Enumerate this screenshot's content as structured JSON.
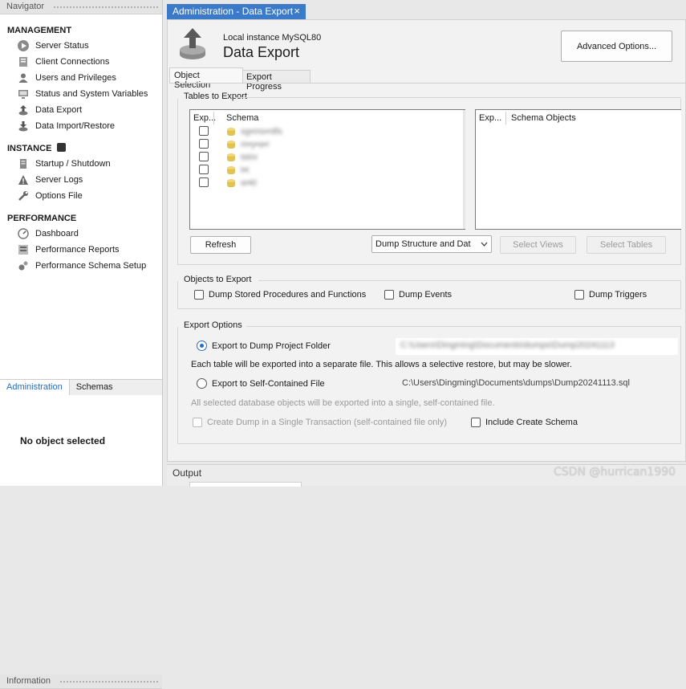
{
  "navigator": {
    "title": "Navigator",
    "management": {
      "title": "MANAGEMENT",
      "items": [
        "Server Status",
        "Client Connections",
        "Users and Privileges",
        "Status and System Variables",
        "Data Export",
        "Data Import/Restore"
      ]
    },
    "instance": {
      "title": "INSTANCE",
      "items": [
        "Startup / Shutdown",
        "Server Logs",
        "Options File"
      ]
    },
    "performance": {
      "title": "PERFORMANCE",
      "items": [
        "Dashboard",
        "Performance Reports",
        "Performance Schema Setup"
      ]
    },
    "tabs": [
      "Administration",
      "Schemas"
    ],
    "information": {
      "title": "Information",
      "text": "No object selected"
    }
  },
  "main_tab": {
    "label": "Administration - Data Export",
    "close": "×"
  },
  "header": {
    "subtitle": "Local instance MySQL80",
    "title": "Data Export",
    "advanced_button": "Advanced Options..."
  },
  "subtabs": [
    "Object Selection",
    "Export Progress"
  ],
  "tables_to_export": {
    "title": "Tables to Export",
    "schema_cols": [
      "Exp...",
      "Schema"
    ],
    "schemas": [
      "sg•ms•ntfs",
      "m•y•a•r",
      "tstnr",
      "t•t",
      "w•kl"
    ],
    "object_cols": [
      "Exp...",
      "Schema Objects"
    ],
    "refresh": "Refresh",
    "dump_select": "Dump Structure and Dat",
    "select_views": "Select Views",
    "select_tables": "Select Tables"
  },
  "objects_to_export": {
    "title": "Objects to Export",
    "procedures": "Dump Stored Procedures and Functions",
    "events": "Dump Events",
    "triggers": "Dump Triggers"
  },
  "export_options": {
    "title": "Export Options",
    "project_folder": "Export to Dump Project Folder",
    "project_path": "C:\\Users\\Dingming\\Documents\\dumps\\Dump20241113",
    "project_note": "Each table will be exported into a separate file. This allows a selective restore, but may be slower.",
    "self_contained": "Export to Self-Contained File",
    "self_path": "C:\\Users\\Dingming\\Documents\\dumps\\Dump20241113.sql",
    "self_note": "All selected database objects will be exported into a single, self-contained file.",
    "single_tx": "Create Dump in a Single Transaction (self-contained file only)",
    "create_schema": "Include Create Schema"
  },
  "output": {
    "title": "Output"
  },
  "watermark": "CSDN @hurrican1990",
  "colors": {
    "accent": "#3a7ac8",
    "radio": "#2a6cc0"
  }
}
